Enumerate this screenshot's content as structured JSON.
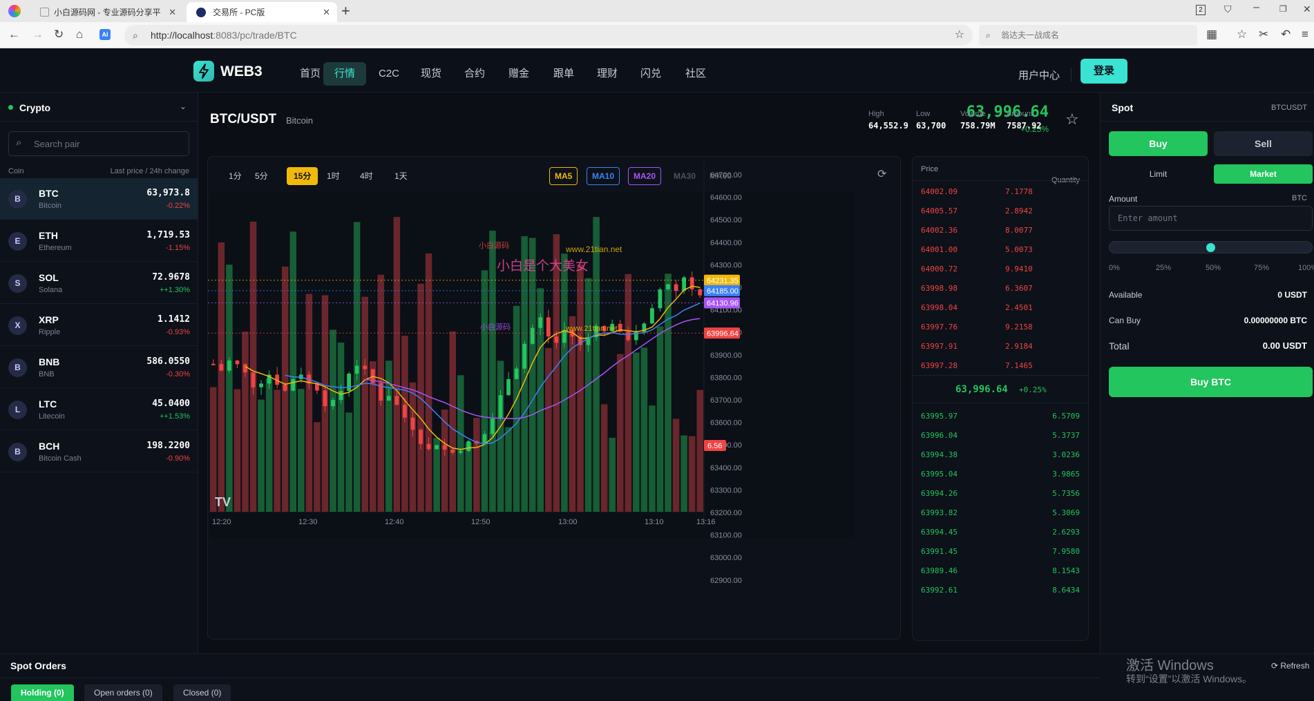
{
  "browser": {
    "tabs": [
      {
        "label": "小白源码网 - 专业源码分享平",
        "close": "✕"
      },
      {
        "label": "交易所 - PC版",
        "close": "✕"
      }
    ],
    "new_tab": "+",
    "url_host": "http://localhost",
    "url_rest": ":8083/pc/trade/BTC",
    "search_placeholder": "翁达夫一战成名",
    "window_badge": "2"
  },
  "nav": {
    "brand": "WEB3",
    "items": [
      "首页",
      "行情",
      "C2C",
      "现货",
      "合约",
      "赠金",
      "跟单",
      "理财",
      "闪兑",
      "社区"
    ],
    "active_index": 1,
    "user_center": "用户中心",
    "login": "登录"
  },
  "sidebar": {
    "title": "Crypto",
    "search_placeholder": "Search pair",
    "col_coin": "Coin",
    "col_price": "Last price / 24h change",
    "coins": [
      {
        "avatar": "B",
        "symbol": "BTC",
        "name": "Bitcoin",
        "price": "63,973.8",
        "change": "-0.22%",
        "dir": "down"
      },
      {
        "avatar": "E",
        "symbol": "ETH",
        "name": "Ethereum",
        "price": "1,719.53",
        "change": "-1.15%",
        "dir": "down"
      },
      {
        "avatar": "S",
        "symbol": "SOL",
        "name": "Solana",
        "price": "72.9678",
        "change": "++1.30%",
        "dir": "up"
      },
      {
        "avatar": "X",
        "symbol": "XRP",
        "name": "Ripple",
        "price": "1.1412",
        "change": "-0.93%",
        "dir": "down"
      },
      {
        "avatar": "B",
        "symbol": "BNB",
        "name": "BNB",
        "price": "586.0550",
        "change": "-0.30%",
        "dir": "down"
      },
      {
        "avatar": "L",
        "symbol": "LTC",
        "name": "Litecoin",
        "price": "45.0400",
        "change": "++1.53%",
        "dir": "up"
      },
      {
        "avatar": "B",
        "symbol": "BCH",
        "name": "Bitcoin Cash",
        "price": "198.2200",
        "change": "-0.90%",
        "dir": "down"
      }
    ]
  },
  "ticker": {
    "pair": "BTC/USDT",
    "name": "Bitcoin",
    "price": "63,996.64",
    "change": "+0.25%",
    "stats": [
      {
        "label": "High",
        "value": "64,552.9"
      },
      {
        "label": "Low",
        "value": "63,700"
      },
      {
        "label": "Volume",
        "value": "758.79M"
      },
      {
        "label": "Amount",
        "value": "7587.92"
      }
    ]
  },
  "chart": {
    "timeframes": [
      "1分",
      "5分",
      "15分",
      "1时",
      "4时",
      "1天"
    ],
    "active_tf": 2,
    "ma_buttons": [
      {
        "label": "MA5",
        "color": "#f0b90b",
        "on": true
      },
      {
        "label": "MA10",
        "color": "#3b82f6",
        "on": true
      },
      {
        "label": "MA20",
        "color": "#a855f7",
        "on": true
      },
      {
        "label": "MA30",
        "color": "#4b5160",
        "on": false
      },
      {
        "label": "MA60",
        "color": "#4b5160",
        "on": false
      }
    ],
    "price_ticks": [
      "64700.00",
      "64600.00",
      "64500.00",
      "64400.00",
      "64300.00",
      "64200.00",
      "64100.00",
      "64000.00",
      "63900.00",
      "63800.00",
      "63700.00",
      "63600.00",
      "63500.00",
      "63400.00",
      "63300.00",
      "63200.00",
      "63100.00",
      "63000.00",
      "62900.00"
    ],
    "time_ticks": [
      "12:20",
      "12:30",
      "12:40",
      "12:50",
      "13:00",
      "13:10",
      "13:16"
    ],
    "tags": [
      {
        "text": "64231.35",
        "color": "#f0b90b"
      },
      {
        "text": "64185.00",
        "color": "#3b82f6"
      },
      {
        "text": "64130.96",
        "color": "#a855f7"
      },
      {
        "text": "63996.64",
        "color": "#ef4444"
      },
      {
        "text": "6.56",
        "color": "#ef4444"
      }
    ],
    "logo": "TV",
    "watermark": [
      "小白源码",
      "www.21tian.net",
      "小白是个大美女",
      "小白源码",
      "www.21tian.net"
    ]
  },
  "chart_data": {
    "type": "candlestick",
    "x_range": [
      "12:20",
      "13:16"
    ],
    "ylim": [
      62900,
      64700
    ],
    "last_price": 63996.64,
    "ma_last": {
      "MA5": 64231.35,
      "MA10": 64185.0,
      "MA20": 64130.96
    },
    "last_volume": 6.56
  },
  "orderbook": {
    "col_price": "Price",
    "col_qty": "Quantity",
    "asks": [
      [
        "64002.09",
        "7.1778"
      ],
      [
        "64005.57",
        "2.8942"
      ],
      [
        "64002.36",
        "8.0077"
      ],
      [
        "64001.00",
        "5.0073"
      ],
      [
        "64000.72",
        "9.9410"
      ],
      [
        "63998.98",
        "6.3607"
      ],
      [
        "63998.04",
        "2.4501"
      ],
      [
        "63997.76",
        "9.2158"
      ],
      [
        "63997.91",
        "2.9184"
      ],
      [
        "63997.28",
        "7.1465"
      ]
    ],
    "mid_price": "63,996.64",
    "mid_change": "+0.25%",
    "bids": [
      [
        "63995.97",
        "6.5709"
      ],
      [
        "63996.04",
        "5.3737"
      ],
      [
        "63994.38",
        "3.0236"
      ],
      [
        "63995.04",
        "3.9865"
      ],
      [
        "63994.26",
        "5.7356"
      ],
      [
        "63993.82",
        "5.3069"
      ],
      [
        "63994.45",
        "2.6293"
      ],
      [
        "63991.45",
        "7.9580"
      ],
      [
        "63989.46",
        "8.1543"
      ],
      [
        "63992.61",
        "8.6434"
      ]
    ]
  },
  "spot": {
    "title": "Spot",
    "pair": "BTCUSDT",
    "buy": "Buy",
    "sell": "Sell",
    "limit": "Limit",
    "market": "Market",
    "amount_label": "Amount",
    "amount_unit": "BTC",
    "amount_placeholder": "Enter amount",
    "slider_value_pct": 50,
    "slider_marks": [
      "0%",
      "25%",
      "50%",
      "75%",
      "100%"
    ],
    "available_label": "Available",
    "available_value": "0 USDT",
    "canbuy_label": "Can Buy",
    "canbuy_value": "0.00000000 BTC",
    "total_label": "Total",
    "total_value": "0.00 USDT",
    "submit": "Buy BTC"
  },
  "orders": {
    "title": "Spot Orders",
    "tabs": [
      "Holding (0)",
      "Open orders (0)",
      "Closed (0)"
    ],
    "refresh": "Refresh"
  },
  "os_watermark": {
    "line1": "激活 Windows",
    "line2": "转到“设置”以激活 Windows。"
  },
  "colors": {
    "up": "#22c55e",
    "down": "#ef4444",
    "accent": "#3be3d2",
    "bg": "#0b0e14"
  }
}
